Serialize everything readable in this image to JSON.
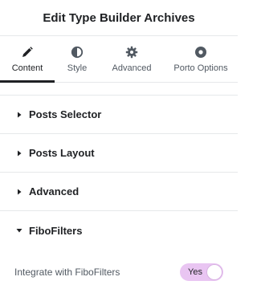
{
  "header": {
    "title": "Edit Type Builder Archives"
  },
  "tabs": [
    {
      "label": "Content",
      "icon": "pencil-icon",
      "active": true
    },
    {
      "label": "Style",
      "icon": "half-circle-icon",
      "active": false
    },
    {
      "label": "Advanced",
      "icon": "gear-icon",
      "active": false
    },
    {
      "label": "Porto Options",
      "icon": "ring-icon",
      "active": false
    }
  ],
  "sections": [
    {
      "label": "Posts Selector",
      "state": "collapsed"
    },
    {
      "label": "Posts Layout",
      "state": "collapsed"
    },
    {
      "label": "Advanced",
      "state": "collapsed"
    },
    {
      "label": "FiboFilters",
      "state": "expanded"
    }
  ],
  "fibofilters": {
    "integrate_label": "Integrate with FiboFilters",
    "toggle": {
      "text": "Yes",
      "on": true
    }
  },
  "colors": {
    "text_primary": "#1f2124",
    "text_secondary": "#515962",
    "divider": "#e6e8ea",
    "toggle_bg": "#e9c5f2"
  }
}
